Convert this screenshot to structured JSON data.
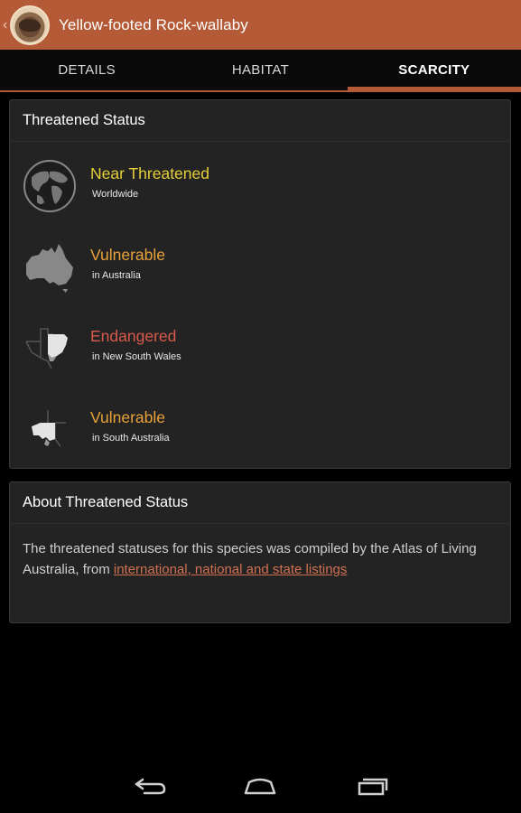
{
  "app": {
    "title": "Yellow-footed Rock-wallaby"
  },
  "tabs": [
    {
      "label": "DETAILS",
      "active": false
    },
    {
      "label": "HABITAT",
      "active": false
    },
    {
      "label": "SCARCITY",
      "active": true
    }
  ],
  "threatened_card": {
    "header": "Threatened Status",
    "statuses": [
      {
        "label": "Near Threatened",
        "scope": "Worldwide",
        "color": "#e4cf3a",
        "icon": "globe-icon"
      },
      {
        "label": "Vulnerable",
        "scope": "in Australia",
        "color": "#e8a23a",
        "icon": "australia-map-icon"
      },
      {
        "label": "Endangered",
        "scope": "in New South Wales",
        "color": "#d85a4a",
        "icon": "nsw-map-icon"
      },
      {
        "label": "Vulnerable",
        "scope": "in South Australia",
        "color": "#e8a23a",
        "icon": "south-australia-map-icon"
      }
    ]
  },
  "about_card": {
    "header": "About Threatened Status",
    "text": "The threatened statuses for this species was compiled by the Atlas of Living Australia, from ",
    "link": "international, national and state listings"
  },
  "colors": {
    "accent": "#b45a36",
    "link": "#d07050"
  }
}
